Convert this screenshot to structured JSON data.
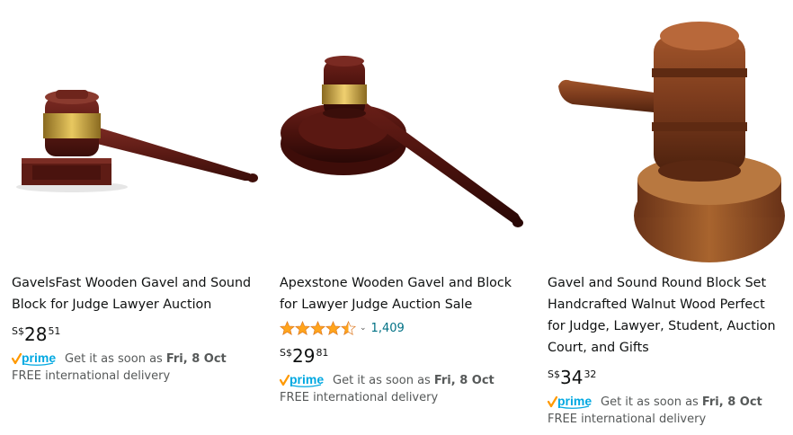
{
  "products": [
    {
      "image_icon": "gavel-with-rectangular-block",
      "title": "GavelsFast Wooden Gavel and Sound Block for Judge Lawyer Auction",
      "price": {
        "currency": "S$",
        "whole": "28",
        "fraction": "51"
      },
      "prime_label": "prime",
      "delivery_text": "Get it as soon as",
      "delivery_date": "Fri, 8 Oct",
      "shipping": "FREE international delivery"
    },
    {
      "image_icon": "gavel-with-round-block",
      "title": "Apexstone Wooden Gavel and Block for Lawyer Judge Auction Sale",
      "rating": {
        "value": 4.5,
        "count": "1,409"
      },
      "price": {
        "currency": "S$",
        "whole": "29",
        "fraction": "81"
      },
      "prime_label": "prime",
      "delivery_text": "Get it as soon as",
      "delivery_date": "Fri, 8 Oct",
      "shipping": "FREE international delivery"
    },
    {
      "image_icon": "walnut-gavel-round-block",
      "title": "Gavel and Sound Round Block Set Handcrafted Walnut Wood Perfect for Judge, Lawyer, Student, Auction Court, and Gifts",
      "price": {
        "currency": "S$",
        "whole": "34",
        "fraction": "32"
      },
      "prime_label": "prime",
      "delivery_text": "Get it as soon as",
      "delivery_date": "Fri, 8 Oct",
      "shipping": "FREE international delivery"
    }
  ],
  "colors": {
    "link": "#007185",
    "star": "#ffa41c",
    "prime_blue": "#00a8e1",
    "prime_check": "#ff9900",
    "text": "#0f1111",
    "muted": "#565959"
  }
}
